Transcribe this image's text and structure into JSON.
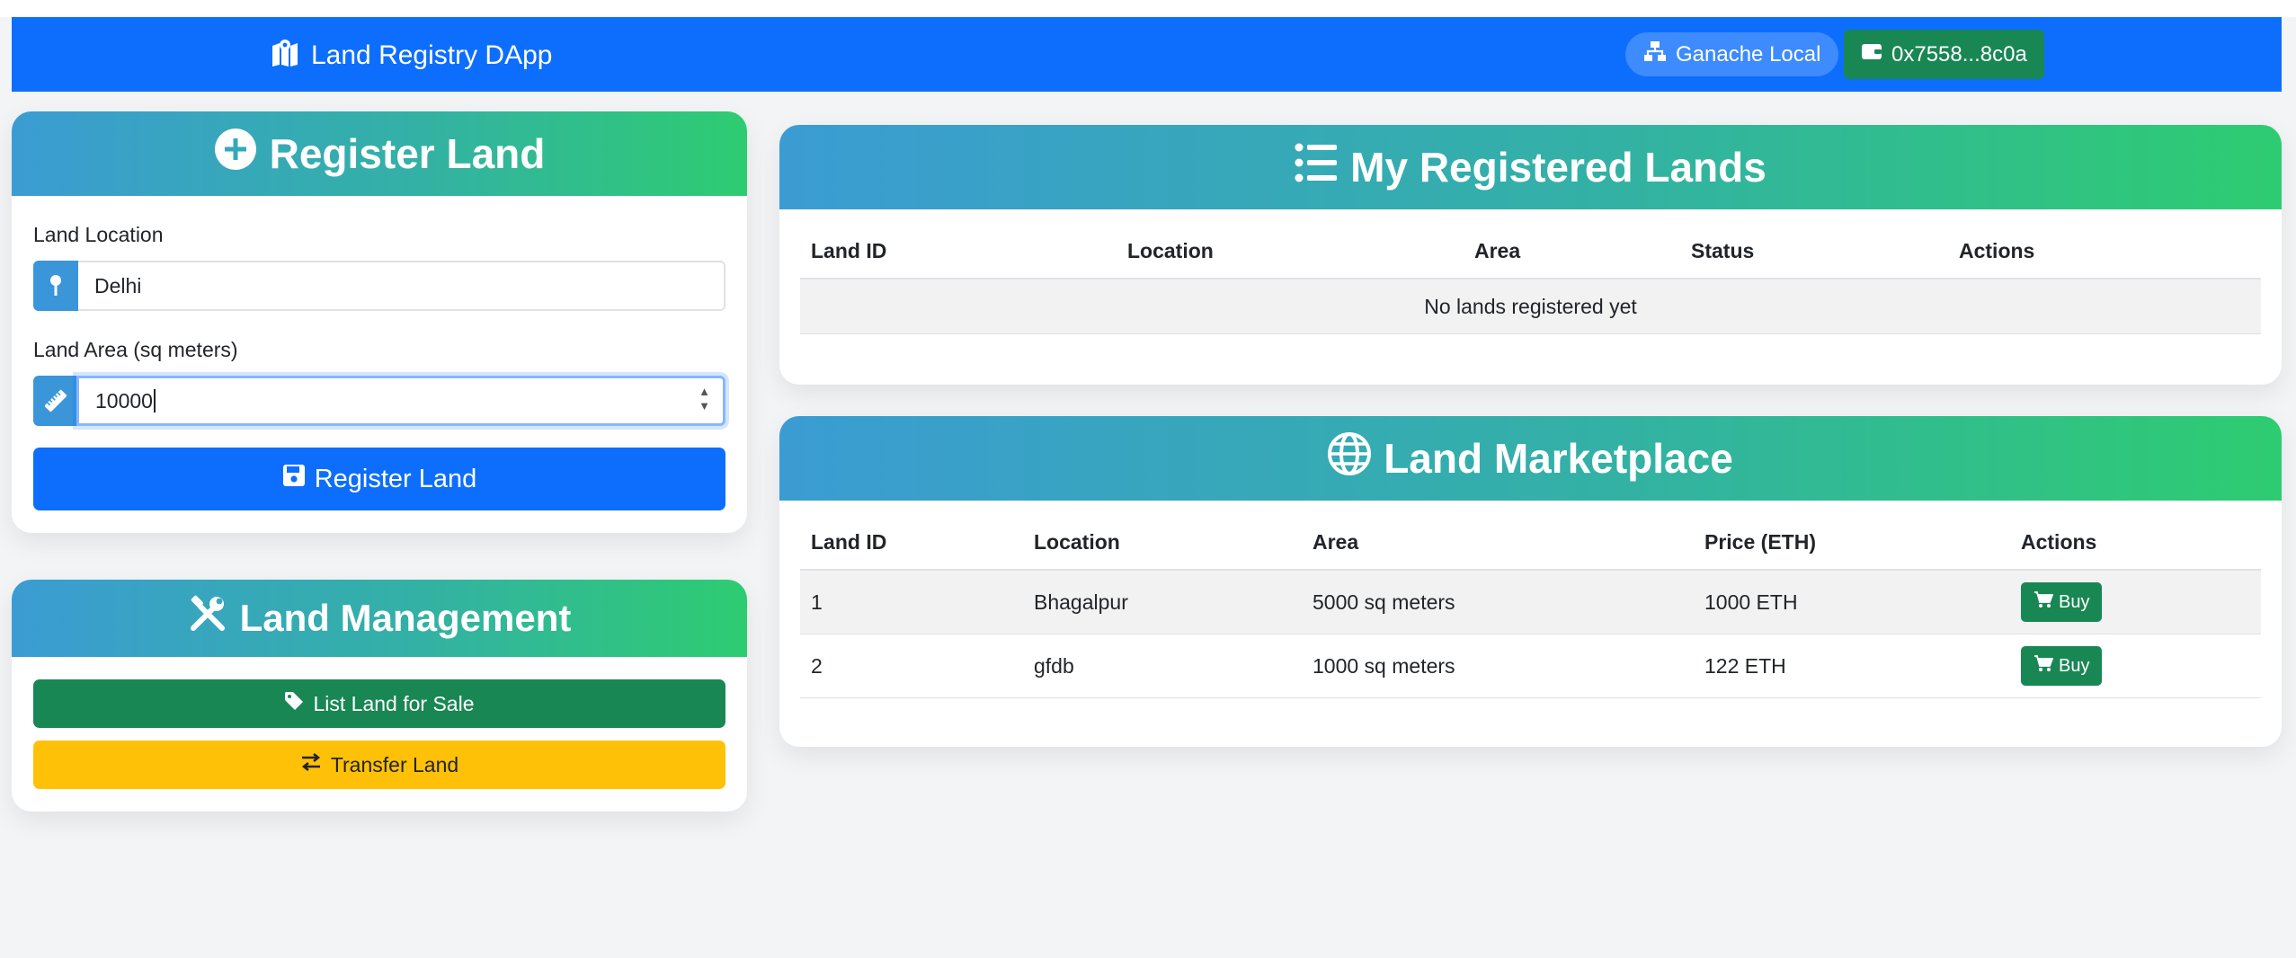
{
  "navbar": {
    "brand": "Land Registry DApp",
    "network": "Ganache Local",
    "account": "0x7558...8c0a"
  },
  "register": {
    "title": "Register Land",
    "location_label": "Land Location",
    "location_value": "Delhi",
    "area_label": "Land Area (sq meters)",
    "area_value": "10000",
    "submit_label": "Register Land"
  },
  "management": {
    "title": "Land Management",
    "list_label": "List Land for Sale",
    "transfer_label": "Transfer Land"
  },
  "my_lands": {
    "title": "My Registered Lands",
    "columns": [
      "Land ID",
      "Location",
      "Area",
      "Status",
      "Actions"
    ],
    "empty_message": "No lands registered yet"
  },
  "marketplace": {
    "title": "Land Marketplace",
    "columns": [
      "Land ID",
      "Location",
      "Area",
      "Price (ETH)",
      "Actions"
    ],
    "rows": [
      {
        "id": "1",
        "location": "Bhagalpur",
        "area": "5000 sq meters",
        "price": "1000 ETH",
        "action": "Buy"
      },
      {
        "id": "2",
        "location": "gfdb",
        "area": "1000 sq meters",
        "price": "122 ETH",
        "action": "Buy"
      }
    ]
  },
  "colors": {
    "primary": "#0d6efd",
    "success": "#198754",
    "warning": "#ffc107",
    "header_gradient_start": "#3b9cd3",
    "header_gradient_end": "#2ecc71"
  }
}
